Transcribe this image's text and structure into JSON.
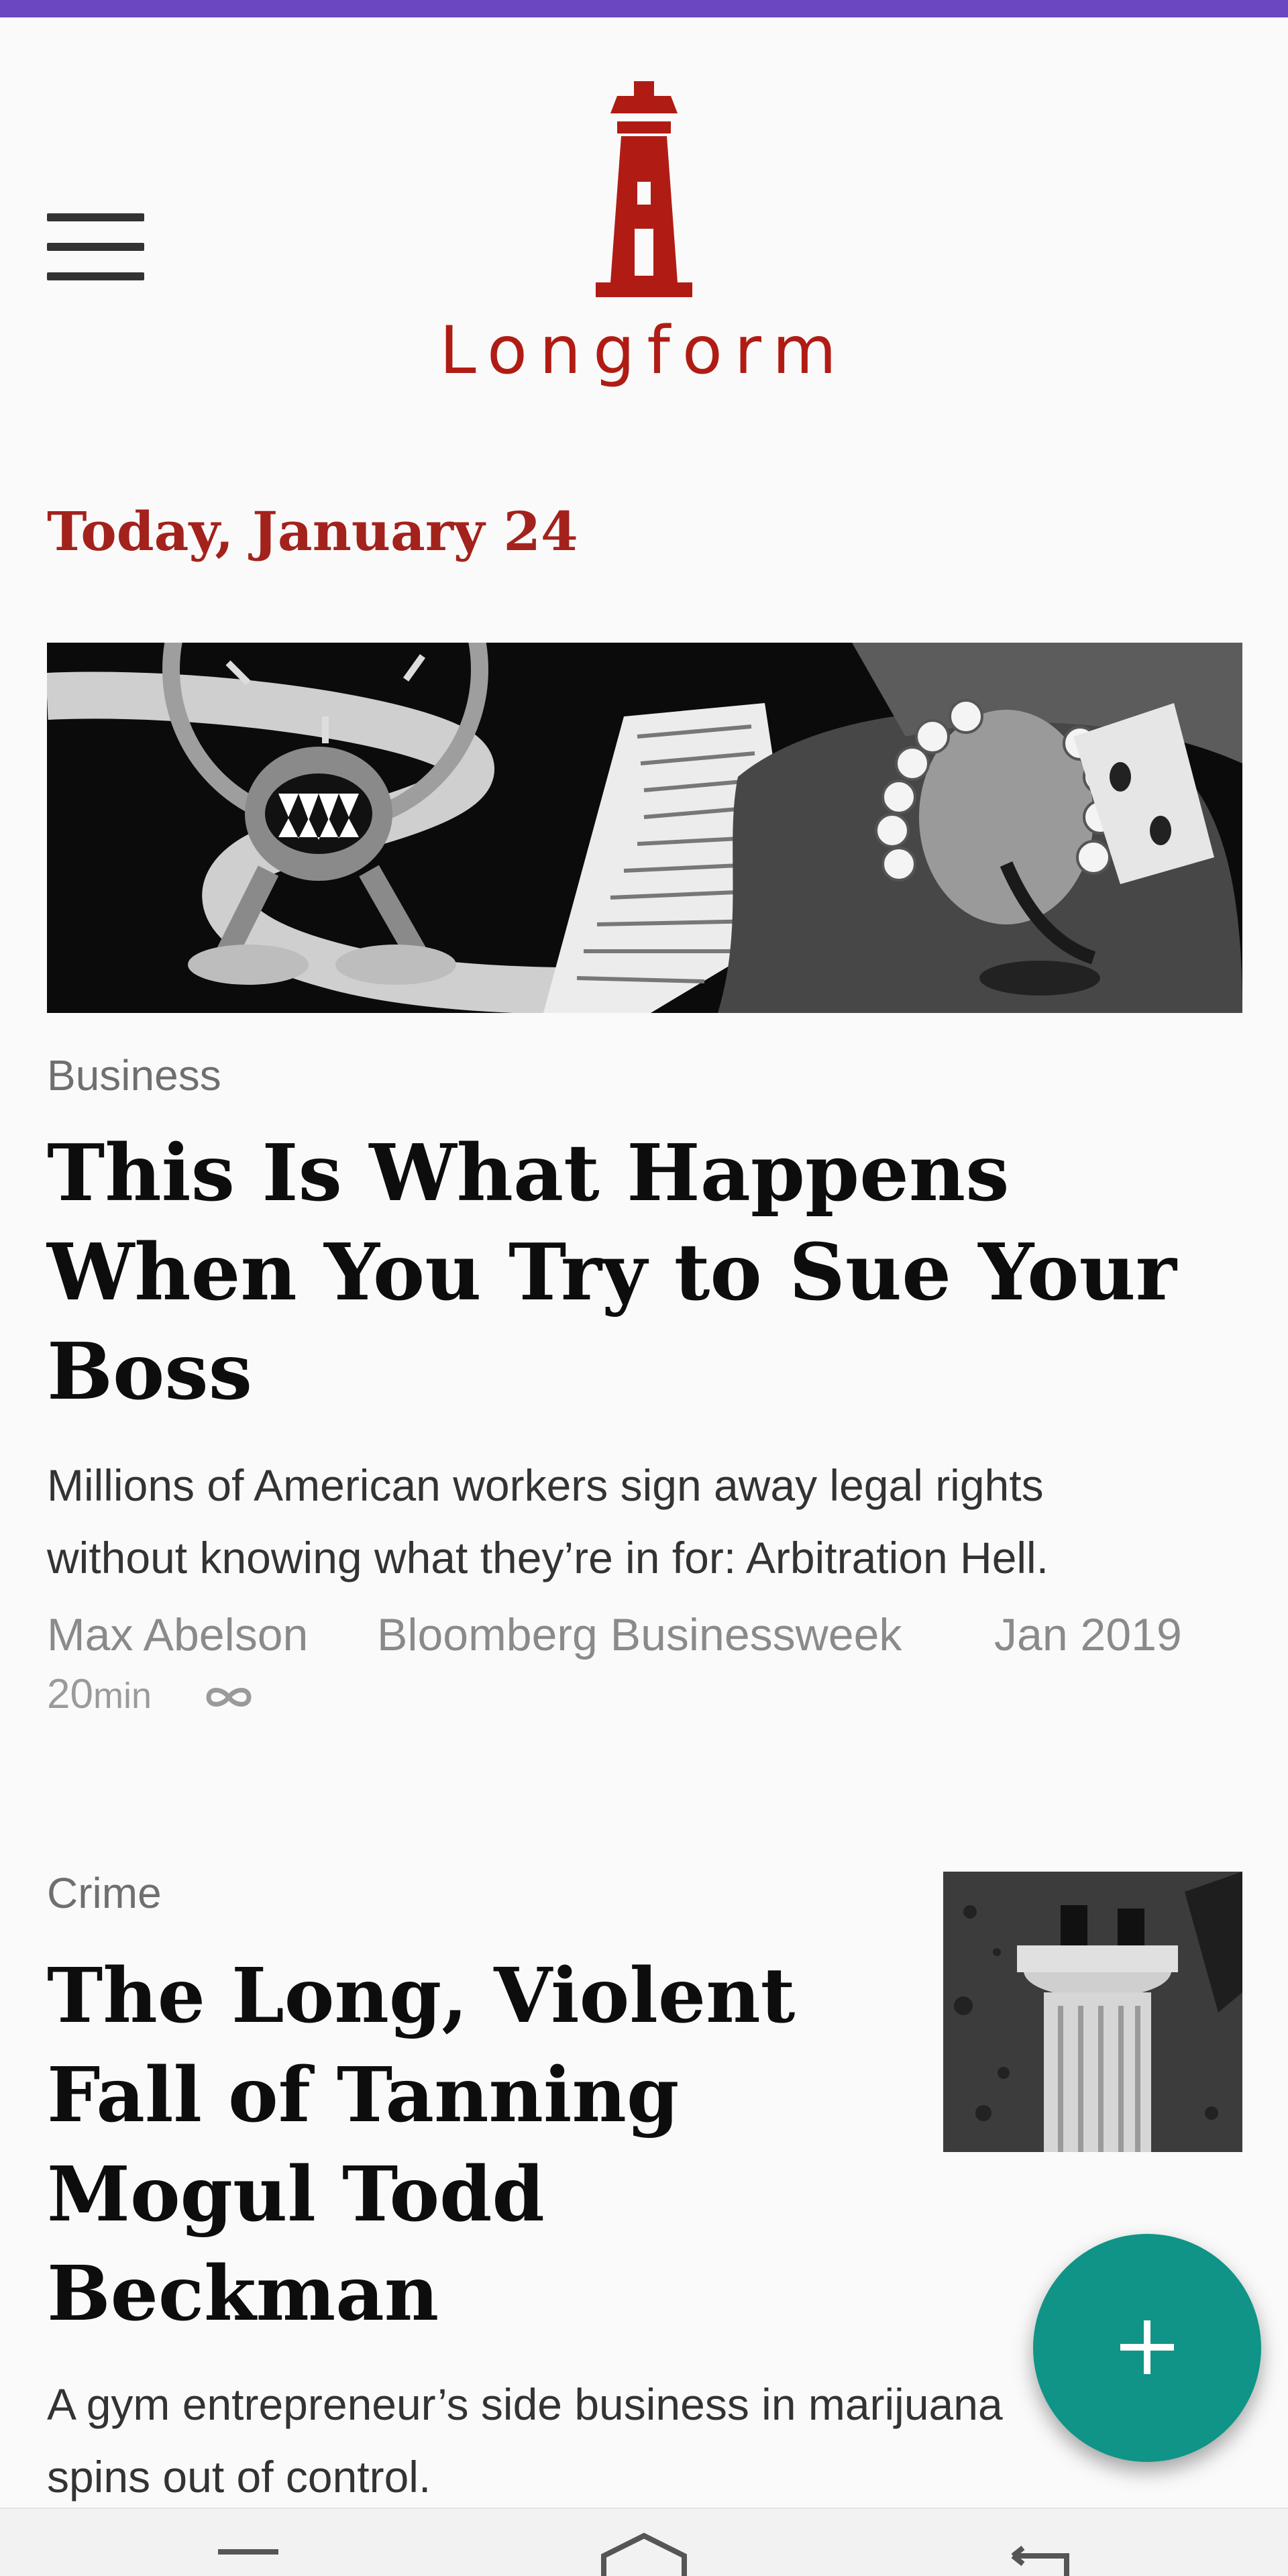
{
  "app": {
    "brand_name": "Longform",
    "brand_color": "#b01c14",
    "accent_color": "#0f9487",
    "status_bar_color": "#6b47c2"
  },
  "header": {
    "menu_icon": "hamburger-menu-icon",
    "logo_icon": "lighthouse-logo-icon"
  },
  "feed": {
    "date_heading": "Today, January 24",
    "articles": [
      {
        "category": "Business",
        "headline_lines": [
          "This Is What Happens",
          "When You Try to Sue Your",
          "Boss"
        ],
        "summary_lines": [
          "Millions of American workers sign away legal rights",
          "without knowing what they’re in for: Arbitration Hell."
        ],
        "author": "Max Abelson",
        "publication": "Bloomberg Businessweek",
        "date": "Jan 2019",
        "read_time": "20",
        "read_time_unit": "min",
        "read_later_icon": "infinity-icon"
      },
      {
        "category": "Crime",
        "headline_lines": [
          "The Long, Violent",
          "Fall of Tanning",
          "Mogul Todd",
          "Beckman"
        ],
        "summary_lines": [
          "A gym entrepreneur’s side business in marijuana",
          "spins out of control."
        ]
      }
    ]
  },
  "fab": {
    "icon": "plus-icon"
  },
  "navigation": {
    "icons": [
      "nav-menu-icon",
      "nav-home-icon",
      "nav-back-icon"
    ]
  }
}
